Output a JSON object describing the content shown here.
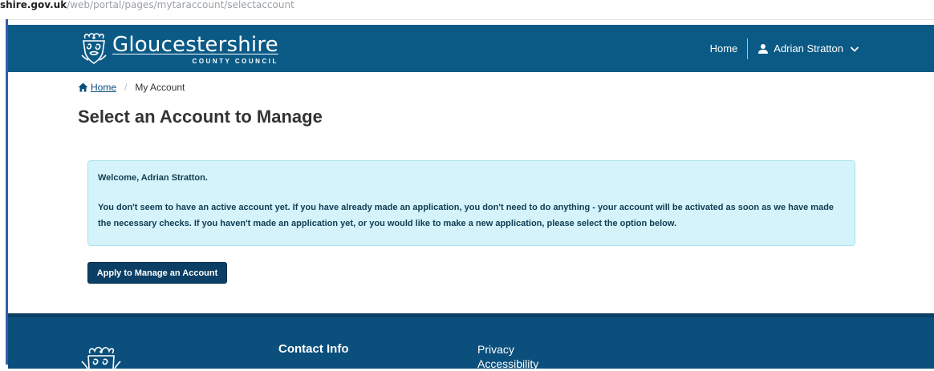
{
  "browser": {
    "url_host": "shire.gov.uk",
    "url_path": "/web/portal/pages/mytaraccount/selectaccount"
  },
  "header": {
    "logo_name": "Gloucestershire",
    "logo_sub": "COUNTY COUNCIL",
    "nav_home": "Home",
    "user_name": "Adrian Stratton"
  },
  "breadcrumb": {
    "home": "Home",
    "separator": "/",
    "current": "My Account"
  },
  "page": {
    "title": "Select an Account to Manage"
  },
  "alert": {
    "welcome": "Welcome, Adrian Stratton.",
    "message": "You don't seem to have an active account yet. If you have already made an application, you don't need to do anything - your account will be activated as soon as we have made the necessary checks. If you haven't made an application yet, or you would like to make a new application, please select the option below."
  },
  "actions": {
    "apply_label": "Apply to Manage an Account"
  },
  "footer": {
    "contact_heading": "Contact Info",
    "links": [
      "Privacy",
      "Accessibility"
    ]
  },
  "colors": {
    "header_bg": "#0b5a86",
    "footer_bg": "#0b4f7c",
    "alert_bg": "#d5f3fa",
    "button_bg": "#0b3f66"
  },
  "icons": {
    "crest": "county-crest-icon",
    "user": "user-icon",
    "chevron": "chevron-down-icon",
    "home": "home-icon"
  }
}
